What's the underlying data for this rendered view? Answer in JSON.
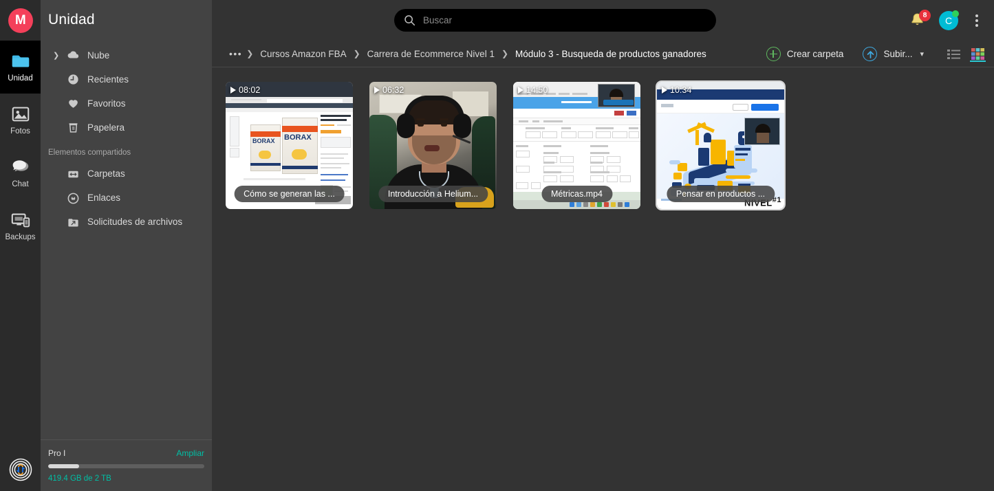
{
  "app": {
    "name": "MEGA",
    "logo_letter": "M",
    "brand_color": "#f4405a"
  },
  "rail": {
    "items": [
      {
        "label": "Unidad",
        "icon": "folder-icon",
        "active": true
      },
      {
        "label": "Fotos",
        "icon": "photos-icon",
        "active": false
      },
      {
        "label": "Chat",
        "icon": "chat-icon",
        "active": false
      },
      {
        "label": "Backups",
        "icon": "backups-icon",
        "active": false
      }
    ],
    "transfers_icon": "transfers-icon"
  },
  "sidebar": {
    "title": "Unidad",
    "items": [
      {
        "label": "Nube",
        "icon": "cloud-icon",
        "expandable": true
      },
      {
        "label": "Recientes",
        "icon": "clock-icon",
        "expandable": false
      },
      {
        "label": "Favoritos",
        "icon": "heart-icon",
        "expandable": false
      },
      {
        "label": "Papelera",
        "icon": "trash-icon",
        "expandable": false
      }
    ],
    "section_label": "Elementos compartidos",
    "shared_items": [
      {
        "label": "Carpetas",
        "icon": "shared-folders-icon"
      },
      {
        "label": "Enlaces",
        "icon": "link-icon"
      },
      {
        "label": "Solicitudes de archivos",
        "icon": "file-request-icon"
      }
    ],
    "storage": {
      "plan": "Pro I",
      "upgrade_label": "Ampliar",
      "quota_text": "419.4 GB de 2 TB",
      "used_percent": 20,
      "accent_color": "#00bfa5"
    }
  },
  "topbar": {
    "search_placeholder": "Buscar",
    "search_value": "",
    "search_icon": "search-icon",
    "notifications": {
      "icon": "bell-icon",
      "count": "8",
      "badge_color": "#e8313c"
    },
    "avatar": {
      "initial": "C",
      "color": "#00bcd4",
      "presence": "online"
    },
    "menu_icon": "kebab-menu-icon"
  },
  "breadcrumb": {
    "overflow": "•••",
    "separator": "❯",
    "items": [
      {
        "label": "Cursos Amazon FBA",
        "current": false
      },
      {
        "label": "Carrera de Ecommerce Nivel 1",
        "current": false
      },
      {
        "label": "Módulo 3 - Busqueda de productos ganadores",
        "current": true
      }
    ],
    "actions": {
      "create_folder": {
        "label": "Crear carpeta",
        "icon": "plus-circle-icon"
      },
      "upload": {
        "label": "Subir...",
        "icon": "upload-circle-icon",
        "chevron": "chevron-down-icon"
      },
      "list_view": {
        "icon": "list-view-icon",
        "active": false
      },
      "grid_view": {
        "icon": "grid-view-icon",
        "active": true
      }
    }
  },
  "files": [
    {
      "name": "Cómo se generan las ...",
      "duration": "08:02",
      "thumbnail": "amazon-listing-screenshot",
      "selected": false
    },
    {
      "name": "Introducción a Helium...",
      "duration": "06:32",
      "thumbnail": "webcam-presenter",
      "selected": false
    },
    {
      "name": "Métricas.mp4",
      "duration": "14:50",
      "thumbnail": "helium10-dashboard",
      "selected": false
    },
    {
      "name": "Pensar en productos ...",
      "duration": "10:34",
      "thumbnail": "isometric-ecommerce",
      "selected": true,
      "overlay_text": "NIVEL",
      "overlay_sup": "#1"
    }
  ]
}
